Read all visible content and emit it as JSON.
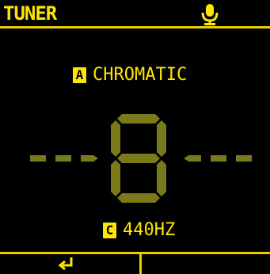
{
  "header": {
    "title": "TUNER",
    "mic_icon": "microphone-icon"
  },
  "mode": {
    "key": "A",
    "label": "CHROMATIC"
  },
  "display": {
    "note_glyph": "8",
    "lit_color": "#ffe600",
    "dim_color": "#7a7a1a"
  },
  "reference": {
    "key": "C",
    "label": "440HZ"
  },
  "footer": {
    "back_icon": "return-arrow-icon"
  },
  "colors": {
    "accent": "#ffe600",
    "background": "#000000"
  }
}
